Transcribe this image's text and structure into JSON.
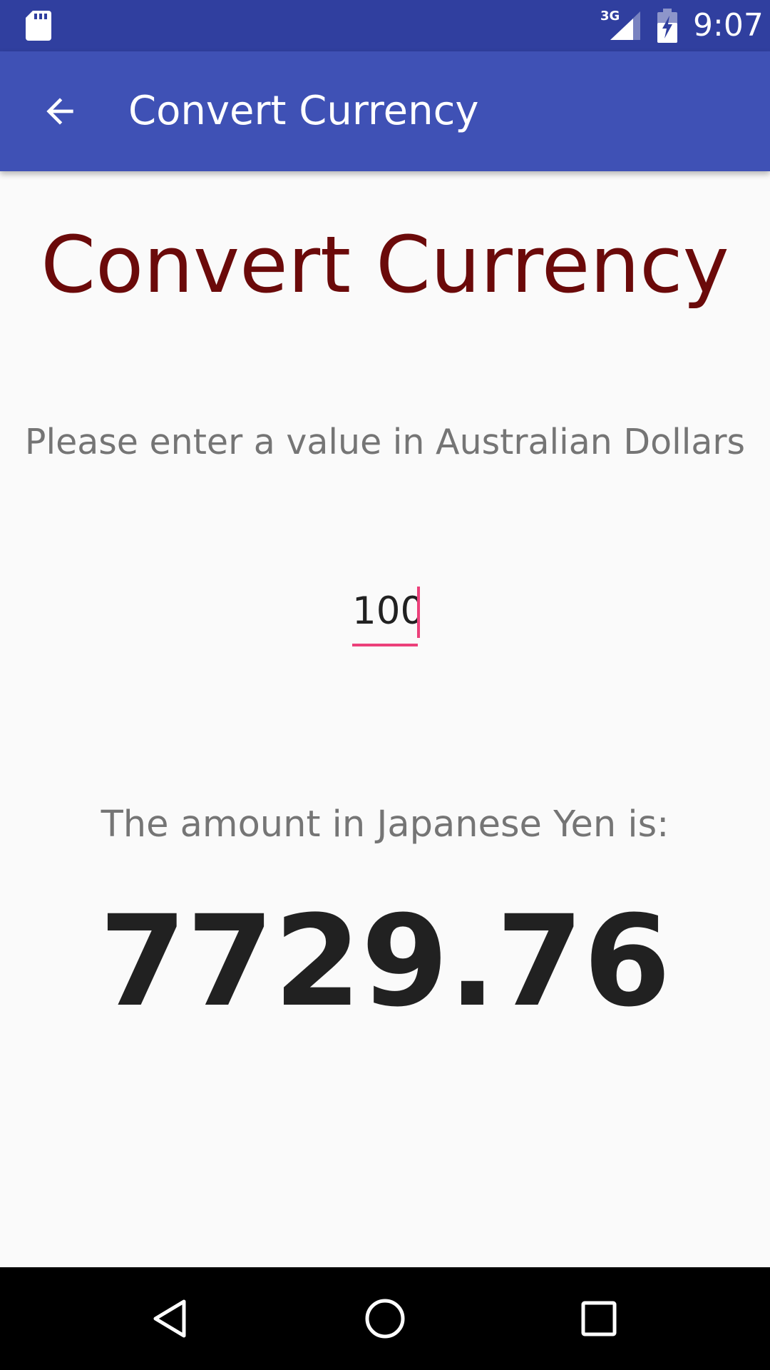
{
  "status_bar": {
    "time": "9:07",
    "network": "3G",
    "icons": [
      "sd-card-icon",
      "signal-3g-icon",
      "battery-charging-icon"
    ]
  },
  "app_bar": {
    "title": "Convert Currency",
    "back_icon": "arrow-back-icon"
  },
  "main": {
    "heading": "Convert Currency",
    "prompt": "Please enter a value in Australian Dollars",
    "amount_value": "100",
    "result_label": "The amount in Japanese Yen is:",
    "result_value": "7729.76"
  },
  "nav_bar": {
    "icons": [
      "nav-back-icon",
      "nav-home-icon",
      "nav-recents-icon"
    ]
  },
  "colors": {
    "status_bar": "#303F9F",
    "app_bar": "#3F51B5",
    "heading": "#6B0A0A",
    "accent": "#EC407A",
    "secondary_text": "#757575",
    "primary_text": "#212121",
    "background": "#FAFAFA"
  }
}
